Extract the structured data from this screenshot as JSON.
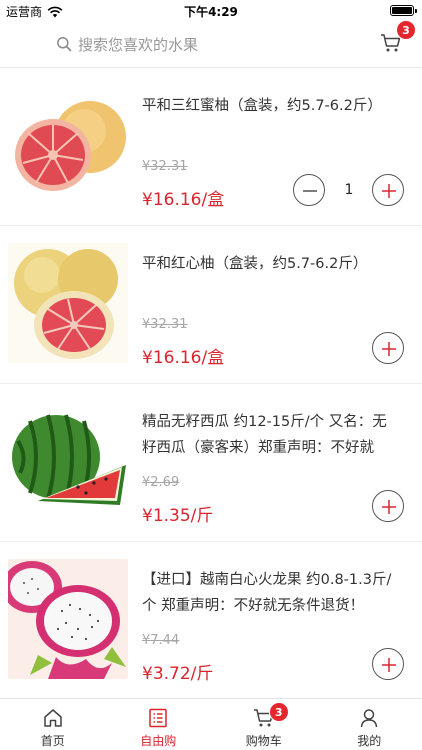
{
  "status_bar": {
    "carrier": "运营商",
    "time": "下午4:29"
  },
  "search": {
    "placeholder": "搜索您喜欢的水果"
  },
  "header_cart": {
    "badge": "3"
  },
  "colors": {
    "accent": "#d9252e",
    "text": "#333333",
    "muted": "#a6a6a6"
  },
  "products": [
    {
      "title": "平和三红蜜柚（盒装，约5.7-6.2斤）",
      "original_price": "¥32.31",
      "price": "¥16.16/盒",
      "quantity": "1",
      "image": "red-pomelo"
    },
    {
      "title": "平和红心柚（盒装，约5.7-6.2斤）",
      "original_price": "¥32.31",
      "price": "¥16.16/盒",
      "image": "red-heart-pomelo"
    },
    {
      "title": "精品无籽西瓜 约12-15斤/个 又名：无籽西瓜（豪客来）郑重声明：不好就",
      "original_price": "¥2.69",
      "price": "¥1.35/斤",
      "image": "watermelon"
    },
    {
      "title": "【进口】越南白心火龙果 约0.8-1.3斤/个 郑重声明：不好就无条件退货！",
      "original_price": "¥7.44",
      "price": "¥3.72/斤",
      "image": "dragon-fruit"
    }
  ],
  "tabbar": {
    "tabs": [
      {
        "label": "首页",
        "icon": "home-icon"
      },
      {
        "label": "自由购",
        "icon": "list-icon",
        "active": true
      },
      {
        "label": "购物车",
        "icon": "cart-icon",
        "badge": "3"
      },
      {
        "label": "我的",
        "icon": "user-icon"
      }
    ]
  }
}
